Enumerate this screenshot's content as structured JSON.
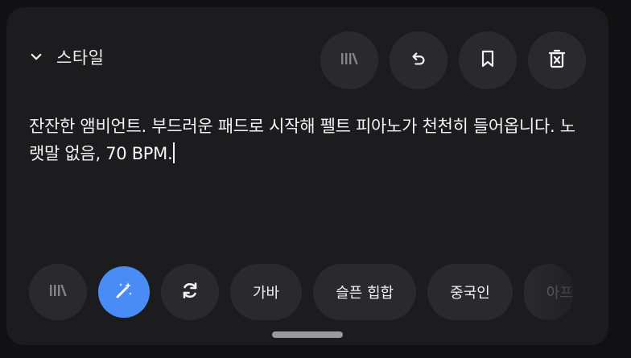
{
  "header": {
    "title": "스타일",
    "collapse_icon": "chevron-down-icon"
  },
  "top_actions": [
    {
      "name": "library-icon",
      "state": "disabled"
    },
    {
      "name": "undo-icon",
      "state": "enabled"
    },
    {
      "name": "bookmark-icon",
      "state": "enabled"
    },
    {
      "name": "delete-icon",
      "state": "enabled"
    }
  ],
  "prompt": {
    "text": "잔잔한 앰비언트. 부드러운 패드로 시작해 펠트 피아노가 천천히 들어옵니다. 노랫말 없음, 70 BPM."
  },
  "bottom": {
    "chips": [
      "가바",
      "슬픈 힙합",
      "중국인",
      "아프"
    ]
  },
  "colors": {
    "panel": "#1c1c1e",
    "button": "#2a2a2d",
    "accent": "#4a8cf5",
    "text": "#f2f2f4"
  }
}
